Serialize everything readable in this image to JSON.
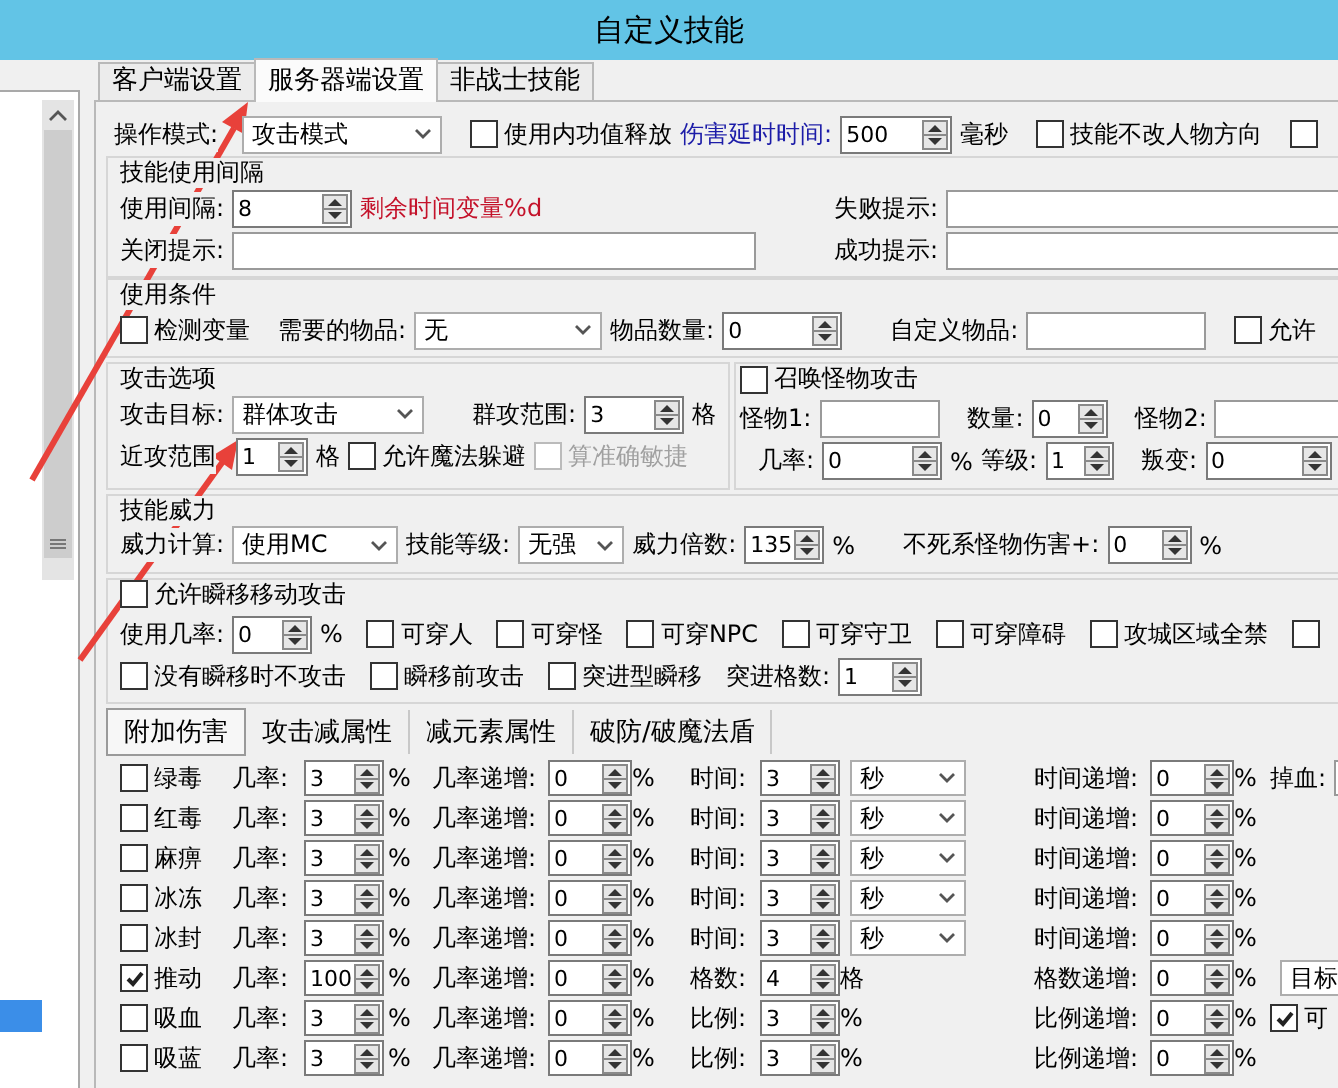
{
  "window": {
    "title": "自定义技能"
  },
  "tabs": [
    {
      "label": "客户端设置",
      "selected": false
    },
    {
      "label": "服务器端设置",
      "selected": true
    },
    {
      "label": "非战士技能",
      "selected": false
    }
  ],
  "operation": {
    "mode_label": "操作模式:",
    "mode": "攻击模式",
    "use_inner_power": {
      "label": "使用内功值释放",
      "checked": false
    },
    "delay_label": "伤害延时时间:",
    "delay": "500",
    "delay_unit": "毫秒",
    "keep_direction": {
      "label": "技能不改人物方向",
      "checked": false
    },
    "extra_check": {
      "checked": false
    }
  },
  "interval": {
    "title": "技能使用间隔",
    "interval_label": "使用间隔:",
    "interval": "8",
    "remaining_hint": "剩余时间变量%d",
    "fail_label": "失败提示:",
    "close_label": "关闭提示:",
    "success_label": "成功提示:"
  },
  "conditions": {
    "title": "使用条件",
    "check_variable": {
      "label": "检测变量",
      "checked": false
    },
    "item_label": "需要的物品:",
    "item": "无",
    "count_label": "物品数量:",
    "count": "0",
    "custom_label": "自定义物品:",
    "allow": {
      "label": "允许",
      "checked": false
    }
  },
  "attack": {
    "title": "攻击选项",
    "target_label": "攻击目标:",
    "target": "群体攻击",
    "range_label": "群攻范围:",
    "range": "3",
    "range_unit": "格",
    "melee_label": "近攻范围",
    "melee": "1",
    "melee_unit": "格",
    "magic_dodge": {
      "label": "允许魔法躲避",
      "checked": false
    },
    "accuracy": {
      "label": "算准确敏捷",
      "checked": false,
      "disabled": true
    }
  },
  "summon": {
    "title": "召唤怪物攻击",
    "checked": false,
    "monster1_label": "怪物1:",
    "count_label": "数量:",
    "count": "0",
    "monster2_label": "怪物2:",
    "chance_label": "几率:",
    "chance": "0",
    "chance_unit": "%",
    "level_label": "等级:",
    "level": "1",
    "rebel_label": "叛变:",
    "rebel": "0"
  },
  "power": {
    "title": "技能威力",
    "calc_label": "威力计算:",
    "calc": "使用MC",
    "level_label": "技能等级:",
    "level": "无强",
    "multiplier_label": "威力倍数:",
    "multiplier": "135",
    "multiplier_unit": "%",
    "undead_label": "不死系怪物伤害+:",
    "undead": "0",
    "undead_unit": "%"
  },
  "teleport": {
    "title": "允许瞬移移动攻击",
    "checked": false,
    "chance_label": "使用几率:",
    "chance": "0",
    "chance_unit": "%",
    "options": [
      {
        "label": "可穿人",
        "checked": false
      },
      {
        "label": "可穿怪",
        "checked": false
      },
      {
        "label": "可穿NPC",
        "checked": false
      },
      {
        "label": "可穿守卫",
        "checked": false
      },
      {
        "label": "可穿障碍",
        "checked": false
      },
      {
        "label": "攻城区域全禁",
        "checked": false
      },
      {
        "checked": false
      }
    ],
    "options2": [
      {
        "label": "没有瞬移时不攻击",
        "checked": false
      },
      {
        "label": "瞬移前攻击",
        "checked": false
      },
      {
        "label": "突进型瞬移",
        "checked": false
      }
    ],
    "dash_label": "突进格数:",
    "dash": "1"
  },
  "effect_tabs": [
    {
      "label": "附加伤害",
      "selected": true
    },
    {
      "label": "攻击减属性",
      "selected": false
    },
    {
      "label": "减元素属性",
      "selected": false
    },
    {
      "label": "破防/破魔法盾",
      "selected": false
    }
  ],
  "effects": [
    {
      "name": "绿毒",
      "checked": false,
      "kind": "timed",
      "chance_label": "几率:",
      "chance": "3",
      "chance_unit": "%",
      "inc_label": "几率递增:",
      "inc": "0",
      "inc_unit": "%",
      "value_label": "时间:",
      "value": "3",
      "time_unit": "秒",
      "value_inc_label": "时间递增:",
      "value_inc": "0",
      "value_inc_unit": "%",
      "extra": {
        "kind": "field",
        "label": "掉血:"
      }
    },
    {
      "name": "红毒",
      "checked": false,
      "kind": "timed",
      "chance_label": "几率:",
      "chance": "3",
      "chance_unit": "%",
      "inc_label": "几率递增:",
      "inc": "0",
      "inc_unit": "%",
      "value_label": "时间:",
      "value": "3",
      "time_unit": "秒",
      "value_inc_label": "时间递增:",
      "value_inc": "0",
      "value_inc_unit": "%"
    },
    {
      "name": "麻痹",
      "checked": false,
      "kind": "timed",
      "chance_label": "几率:",
      "chance": "3",
      "chance_unit": "%",
      "inc_label": "几率递增:",
      "inc": "0",
      "inc_unit": "%",
      "value_label": "时间:",
      "value": "3",
      "time_unit": "秒",
      "value_inc_label": "时间递增:",
      "value_inc": "0",
      "value_inc_unit": "%"
    },
    {
      "name": "冰冻",
      "checked": false,
      "kind": "timed",
      "chance_label": "几率:",
      "chance": "3",
      "chance_unit": "%",
      "inc_label": "几率递增:",
      "inc": "0",
      "inc_unit": "%",
      "value_label": "时间:",
      "value": "3",
      "time_unit": "秒",
      "value_inc_label": "时间递增:",
      "value_inc": "0",
      "value_inc_unit": "%"
    },
    {
      "name": "冰封",
      "checked": false,
      "kind": "timed",
      "chance_label": "几率:",
      "chance": "3",
      "chance_unit": "%",
      "inc_label": "几率递增:",
      "inc": "0",
      "inc_unit": "%",
      "value_label": "时间:",
      "value": "3",
      "time_unit": "秒",
      "value_inc_label": "时间递增:",
      "value_inc": "0",
      "value_inc_unit": "%"
    },
    {
      "name": "推动",
      "checked": true,
      "kind": "unit",
      "chance_label": "几率:",
      "chance": "100",
      "chance_unit": "%",
      "inc_label": "几率递增:",
      "inc": "0",
      "inc_unit": "%",
      "value_label": "格数:",
      "value": "4",
      "value_unit": "格",
      "value_inc_label": "格数递增:",
      "value_inc": "0",
      "value_inc_unit": "%",
      "extra": {
        "kind": "dropdown",
        "value": "目标"
      }
    },
    {
      "name": "吸血",
      "checked": false,
      "kind": "unit",
      "chance_label": "几率:",
      "chance": "3",
      "chance_unit": "%",
      "inc_label": "几率递增:",
      "inc": "0",
      "inc_unit": "%",
      "value_label": "比例:",
      "value": "3",
      "value_unit": "%",
      "value_inc_label": "比例递增:",
      "value_inc": "0",
      "value_inc_unit": "%",
      "extra": {
        "kind": "check",
        "label": "可",
        "checked": true
      }
    },
    {
      "name": "吸蓝",
      "checked": false,
      "kind": "unit",
      "chance_label": "几率:",
      "chance": "3",
      "chance_unit": "%",
      "inc_label": "几率递增:",
      "inc": "0",
      "inc_unit": "%",
      "value_label": "比例:",
      "value": "3",
      "value_unit": "%",
      "value_inc_label": "比例递增:",
      "value_inc": "0",
      "value_inc_unit": "%"
    }
  ]
}
